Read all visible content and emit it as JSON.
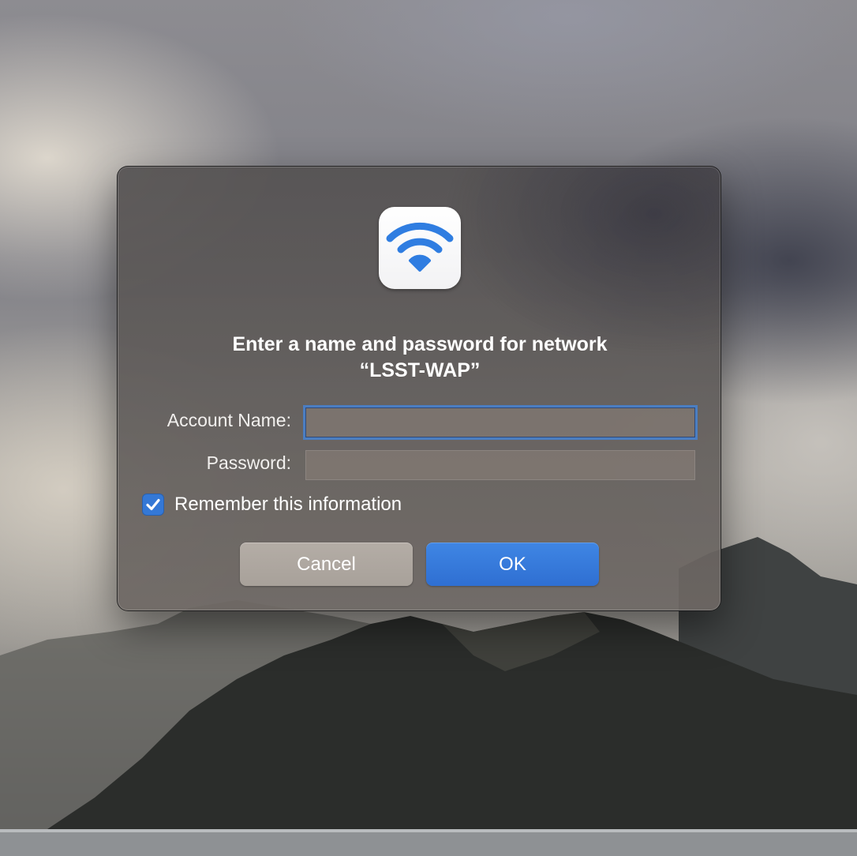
{
  "dialog": {
    "icon": "wifi-icon",
    "title_line_1": "Enter a name and password for network",
    "title_line_2": "“LSST-WAP”",
    "account_name_label": "Account Name:",
    "account_name_value": "",
    "password_label": "Password:",
    "password_value": "",
    "remember_label": "Remember this information",
    "remember_checked": true,
    "cancel_label": "Cancel",
    "ok_label": "OK"
  },
  "colors": {
    "accent": "#3478d6",
    "wifi_icon": "#2f7de1",
    "cancel_button": "#aea79f",
    "ok_button": "#3579db"
  }
}
